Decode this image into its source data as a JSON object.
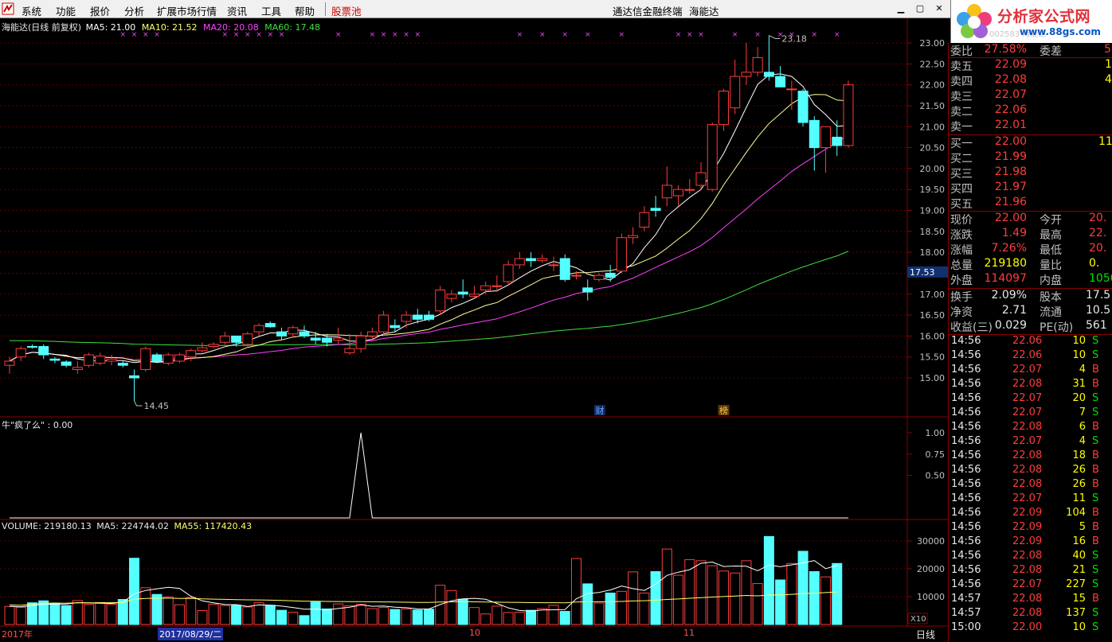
{
  "menubar": {
    "items": [
      "系统",
      "功能",
      "报价",
      "分析",
      "扩展市场行情",
      "资讯",
      "工具",
      "帮助"
    ],
    "special": "股票池",
    "terminal_title": "通达信金融终端",
    "stock_name": "海能达"
  },
  "watermark": {
    "title": "分析家公式网",
    "url": "www.88gs.com",
    "ghost": "002583 海能达"
  },
  "main_chart": {
    "legend_name": "海能达(日线 前复权)",
    "ma5": "MA5: 21.00",
    "ma10": "MA10: 21.52",
    "ma20": "MA20: 20.08",
    "ma60": "MA60: 17.48",
    "high_label": "23.18",
    "low_label": "14.45",
    "current_price_tag": "17.53",
    "marker_cai": "财",
    "marker_bang": "榜",
    "colors": {
      "ma5": "#ffffff",
      "ma10": "#ffff99",
      "ma20": "#ff40ff",
      "ma60": "#40e040",
      "up": "#ff3c3c",
      "down": "#54ffff"
    }
  },
  "indicator": {
    "legend": "牛\"疯了么\" : 0.00",
    "ticks": [
      "1.00",
      "0.75",
      "0.50"
    ]
  },
  "volume": {
    "legend_vol": "VOLUME: 219180.13",
    "legend_ma5": "MA5: 224744.02",
    "legend_ma55": "MA55: 117420.43",
    "ticks": [
      "30000",
      "20000",
      "10000"
    ],
    "unit": "X10"
  },
  "bottom": {
    "year": "2017年",
    "date_cursor": "2017/08/29/二",
    "month_10": "10",
    "month_11": "11",
    "period": "日线"
  },
  "chart_data": {
    "type": "candlestick",
    "price_ylim": [
      14.2,
      23.4
    ],
    "price_ticks": [
      23.0,
      22.5,
      22.0,
      21.5,
      21.0,
      20.5,
      20.0,
      19.5,
      19.0,
      18.5,
      18.0,
      17.5,
      17.0,
      16.5,
      16.0,
      15.5,
      15.0
    ],
    "candles": [
      [
        15.3,
        15.5,
        15.1,
        15.4
      ],
      [
        15.5,
        15.75,
        15.4,
        15.7
      ],
      [
        15.75,
        15.8,
        15.7,
        15.73
      ],
      [
        15.75,
        15.8,
        15.45,
        15.55
      ],
      [
        15.45,
        15.5,
        15.35,
        15.42
      ],
      [
        15.38,
        15.42,
        15.25,
        15.3
      ],
      [
        15.2,
        15.4,
        15.1,
        15.25
      ],
      [
        15.3,
        15.6,
        15.25,
        15.55
      ],
      [
        15.35,
        15.6,
        15.3,
        15.52
      ],
      [
        15.4,
        15.55,
        15.3,
        15.45
      ],
      [
        15.35,
        15.4,
        15.25,
        15.3
      ],
      [
        15.05,
        15.2,
        14.45,
        15.0
      ],
      [
        15.2,
        15.75,
        15.15,
        15.7
      ],
      [
        15.55,
        15.6,
        15.35,
        15.4
      ],
      [
        15.35,
        15.6,
        15.3,
        15.55
      ],
      [
        15.4,
        15.6,
        15.35,
        15.55
      ],
      [
        15.5,
        15.7,
        15.4,
        15.65
      ],
      [
        15.65,
        15.85,
        15.6,
        15.72
      ],
      [
        15.75,
        15.85,
        15.7,
        15.8
      ],
      [
        15.85,
        16.1,
        15.8,
        16.0
      ],
      [
        16.0,
        15.9,
        15.75,
        15.85
      ],
      [
        15.8,
        16.1,
        15.75,
        16.05
      ],
      [
        16.1,
        16.3,
        16.0,
        16.25
      ],
      [
        16.3,
        16.35,
        16.2,
        16.22
      ],
      [
        16.1,
        16.2,
        15.9,
        16.0
      ],
      [
        16.05,
        16.25,
        15.95,
        16.2
      ],
      [
        16.1,
        16.25,
        15.95,
        16.0
      ],
      [
        15.95,
        16.1,
        15.8,
        15.9
      ],
      [
        15.95,
        16.05,
        15.75,
        15.85
      ],
      [
        15.9,
        16.2,
        15.8,
        15.95
      ],
      [
        15.6,
        16.05,
        15.55,
        15.7
      ],
      [
        15.7,
        16.1,
        15.6,
        16.0
      ],
      [
        16.0,
        16.2,
        15.9,
        16.1
      ],
      [
        16.1,
        16.6,
        16.0,
        16.5
      ],
      [
        16.25,
        16.4,
        16.1,
        16.2
      ],
      [
        16.35,
        16.6,
        16.2,
        16.5
      ],
      [
        16.5,
        16.65,
        16.3,
        16.4
      ],
      [
        16.5,
        16.6,
        16.35,
        16.4
      ],
      [
        16.6,
        17.2,
        16.5,
        17.1
      ],
      [
        16.9,
        17.1,
        16.8,
        17.0
      ],
      [
        17.05,
        17.35,
        16.9,
        17.0
      ],
      [
        16.95,
        17.2,
        16.9,
        17.0
      ],
      [
        17.1,
        17.3,
        17.0,
        17.2
      ],
      [
        17.2,
        17.45,
        17.05,
        17.2
      ],
      [
        17.3,
        17.8,
        17.2,
        17.7
      ],
      [
        17.7,
        18.0,
        17.6,
        17.85
      ],
      [
        17.85,
        18.0,
        17.65,
        17.8
      ],
      [
        17.8,
        17.95,
        17.75,
        17.85
      ],
      [
        17.7,
        17.9,
        17.55,
        17.7
      ],
      [
        17.85,
        17.95,
        17.3,
        17.35
      ],
      [
        17.45,
        17.55,
        17.35,
        17.45
      ],
      [
        17.15,
        17.35,
        16.85,
        17.05
      ],
      [
        17.35,
        17.5,
        17.3,
        17.45
      ],
      [
        17.5,
        17.7,
        17.3,
        17.4
      ],
      [
        17.55,
        18.45,
        17.5,
        18.35
      ],
      [
        18.35,
        18.6,
        18.2,
        18.4
      ],
      [
        18.6,
        19.1,
        18.5,
        18.95
      ],
      [
        19.05,
        19.35,
        18.85,
        19.0
      ],
      [
        19.3,
        20.05,
        19.1,
        19.6
      ],
      [
        19.35,
        19.6,
        19.1,
        19.5
      ],
      [
        19.5,
        19.75,
        19.4,
        19.5
      ],
      [
        19.6,
        20.15,
        19.5,
        19.9
      ],
      [
        19.5,
        21.1,
        19.45,
        21.05
      ],
      [
        21.05,
        21.9,
        20.9,
        21.85
      ],
      [
        21.45,
        22.6,
        21.3,
        22.2
      ],
      [
        22.2,
        23.0,
        22.0,
        22.3
      ],
      [
        22.3,
        22.9,
        22.2,
        22.65
      ],
      [
        22.3,
        23.18,
        22.1,
        22.2
      ],
      [
        22.2,
        22.45,
        21.95,
        21.95
      ],
      [
        21.9,
        22.1,
        21.4,
        21.9
      ],
      [
        21.85,
        21.9,
        21.0,
        21.1
      ],
      [
        21.15,
        21.25,
        19.95,
        20.5
      ],
      [
        20.5,
        21.0,
        19.9,
        21.0
      ],
      [
        20.75,
        21.15,
        20.3,
        20.55
      ],
      [
        20.55,
        22.1,
        20.5,
        22.0
      ]
    ],
    "volume_ylim": [
      0,
      36000
    ],
    "volume": [
      6500,
      6200,
      7800,
      8500,
      7600,
      6800,
      8600,
      7200,
      7900,
      7300,
      9000,
      23800,
      13200,
      10800,
      9900,
      7100,
      9700,
      5000,
      7300,
      6800,
      6900,
      6300,
      7800,
      6900,
      5100,
      4400,
      3200,
      8100,
      5600,
      7400,
      6700,
      7300,
      5700,
      6100,
      5400,
      5600,
      5200,
      5500,
      14100,
      12200,
      9100,
      6100,
      3800,
      6600,
      4300,
      4400,
      5100,
      5700,
      6900,
      4700,
      23700,
      14600,
      7700,
      11300,
      11900,
      18900,
      11300,
      19000,
      27100,
      17700,
      23300,
      22900,
      21100,
      19200,
      18500,
      22900,
      14700,
      31600,
      16000,
      21918,
      26300,
      19000,
      17100,
      21918
    ]
  },
  "right_panel": {
    "weibi": {
      "label": "委比",
      "value": "27.58%",
      "label2": "委差",
      "value2": "5"
    },
    "sells": [
      {
        "label": "卖五",
        "price": "22.09",
        "vol": "1"
      },
      {
        "label": "卖四",
        "price": "22.08",
        "vol": "4"
      },
      {
        "label": "卖三",
        "price": "22.07",
        "vol": ""
      },
      {
        "label": "卖二",
        "price": "22.06",
        "vol": ""
      },
      {
        "label": "卖一",
        "price": "22.01",
        "vol": ""
      }
    ],
    "buys": [
      {
        "label": "买一",
        "price": "22.00",
        "vol": "11"
      },
      {
        "label": "买二",
        "price": "21.99",
        "vol": ""
      },
      {
        "label": "买三",
        "price": "21.98",
        "vol": ""
      },
      {
        "label": "买四",
        "price": "21.97",
        "vol": ""
      },
      {
        "label": "买五",
        "price": "21.96",
        "vol": ""
      }
    ],
    "stats": [
      {
        "l1": "现价",
        "v1": "22.00",
        "c1": "red",
        "l2": "今开",
        "v2": "20.",
        "c2": "red"
      },
      {
        "l1": "涨跌",
        "v1": "1.49",
        "c1": "red",
        "l2": "最高",
        "v2": "22.",
        "c2": "red"
      },
      {
        "l1": "涨幅",
        "v1": "7.26%",
        "c1": "red",
        "l2": "最低",
        "v2": "20.",
        "c2": "red"
      },
      {
        "l1": "总量",
        "v1": "219180",
        "c1": "yellow",
        "l2": "量比",
        "v2": "0.",
        "c2": "yellow"
      },
      {
        "l1": "外盘",
        "v1": "114097",
        "c1": "red",
        "l2": "内盘",
        "v2": "1050",
        "c2": "green"
      }
    ],
    "stats2": [
      {
        "l1": "换手",
        "v1": "2.09%",
        "l2": "股本",
        "v2": "17.5"
      },
      {
        "l1": "净资",
        "v1": "2.71",
        "l2": "流通",
        "v2": "10.5"
      },
      {
        "l1": "收益(三)",
        "v1": "0.029",
        "l2": "PE(动)",
        "v2": "561"
      }
    ],
    "trades": [
      {
        "t": "14:56",
        "p": "22.06",
        "v": "10",
        "bs": "S"
      },
      {
        "t": "14:56",
        "p": "22.06",
        "v": "10",
        "bs": "S"
      },
      {
        "t": "14:56",
        "p": "22.07",
        "v": "4",
        "bs": "B"
      },
      {
        "t": "14:56",
        "p": "22.08",
        "v": "31",
        "bs": "B"
      },
      {
        "t": "14:56",
        "p": "22.07",
        "v": "20",
        "bs": "S"
      },
      {
        "t": "14:56",
        "p": "22.07",
        "v": "7",
        "bs": "S"
      },
      {
        "t": "14:56",
        "p": "22.08",
        "v": "6",
        "bs": "B"
      },
      {
        "t": "14:56",
        "p": "22.07",
        "v": "4",
        "bs": "S"
      },
      {
        "t": "14:56",
        "p": "22.08",
        "v": "18",
        "bs": "B"
      },
      {
        "t": "14:56",
        "p": "22.08",
        "v": "26",
        "bs": "B"
      },
      {
        "t": "14:56",
        "p": "22.08",
        "v": "26",
        "bs": "B"
      },
      {
        "t": "14:56",
        "p": "22.07",
        "v": "11",
        "bs": "S"
      },
      {
        "t": "14:56",
        "p": "22.09",
        "v": "104",
        "bs": "B"
      },
      {
        "t": "14:56",
        "p": "22.09",
        "v": "5",
        "bs": "B"
      },
      {
        "t": "14:56",
        "p": "22.09",
        "v": "16",
        "bs": "B"
      },
      {
        "t": "14:56",
        "p": "22.08",
        "v": "40",
        "bs": "S"
      },
      {
        "t": "14:56",
        "p": "22.08",
        "v": "21",
        "bs": "S"
      },
      {
        "t": "14:56",
        "p": "22.07",
        "v": "227",
        "bs": "S"
      },
      {
        "t": "14:57",
        "p": "22.08",
        "v": "15",
        "bs": "B"
      },
      {
        "t": "14:57",
        "p": "22.08",
        "v": "137",
        "bs": "S"
      },
      {
        "t": "15:00",
        "p": "22.00",
        "v": "10",
        "bs": "S"
      }
    ]
  }
}
